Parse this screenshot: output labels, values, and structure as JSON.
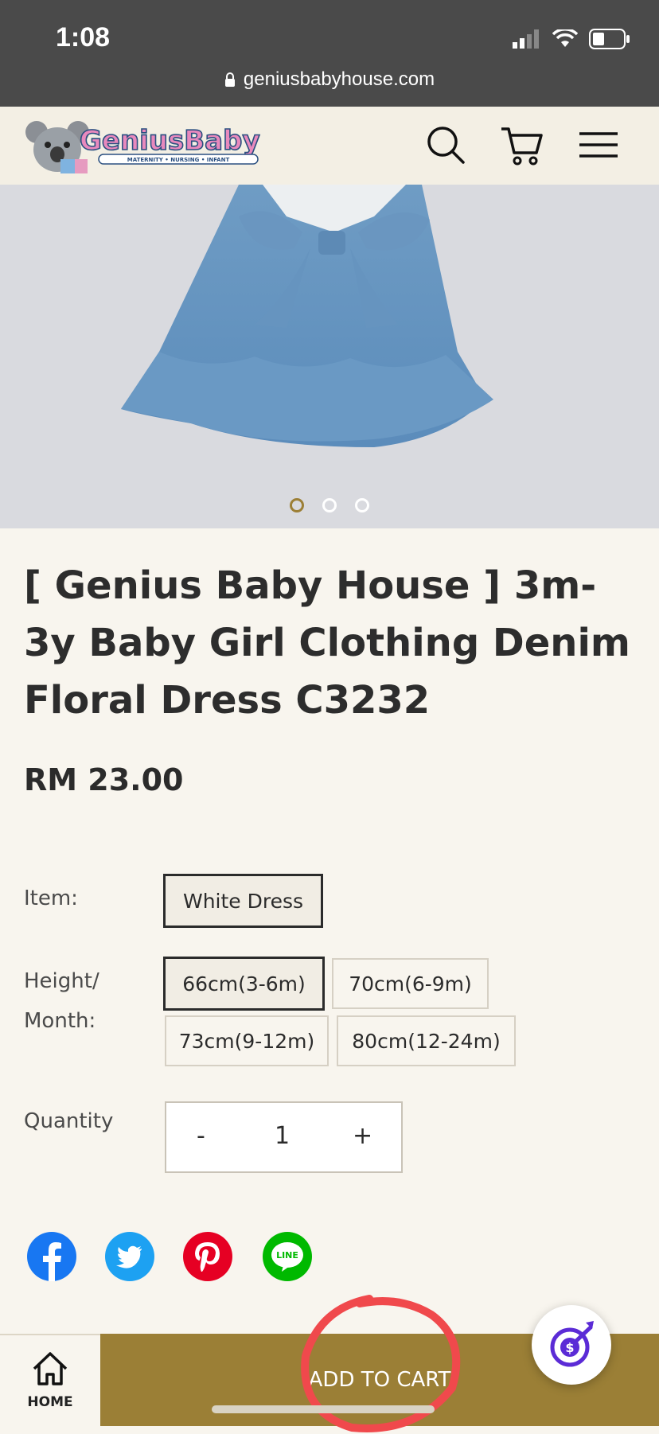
{
  "status_bar": {
    "time": "1:08",
    "url": "geniusbabyhouse.com"
  },
  "header": {
    "logo_text": "GeniusBaby",
    "logo_tagline": "MATERNITY • NURSING • INFANT"
  },
  "gallery": {
    "total_images": 3,
    "active_index": 0
  },
  "product": {
    "title": "[ Genius Baby House ] 3m-3y Baby Girl Clothing Denim Floral Dress C3232",
    "price": "RM 23.00"
  },
  "options": {
    "item_label": "Item:",
    "item_values": [
      "White Dress"
    ],
    "height_label_line1": "Height/",
    "height_label_line2": "Month:",
    "height_values": [
      "66cm(3-6m)",
      "70cm(6-9m)",
      "73cm(9-12m)",
      "80cm(12-24m)"
    ],
    "quantity_label": "Quantity",
    "quantity_value": "1",
    "minus": "-",
    "plus": "+"
  },
  "social": [
    "facebook",
    "twitter",
    "pinterest",
    "line"
  ],
  "line_logo_text": "LINE",
  "bottom_bar": {
    "home_label": "HOME",
    "add_to_cart": "ADD TO CART"
  },
  "colors": {
    "accent": "#9b7f36",
    "background": "#f8f5ee",
    "facebook": "#1877f2",
    "twitter": "#1da1f2",
    "pinterest": "#e60023",
    "line": "#00b900",
    "annotation": "#f0494c"
  }
}
